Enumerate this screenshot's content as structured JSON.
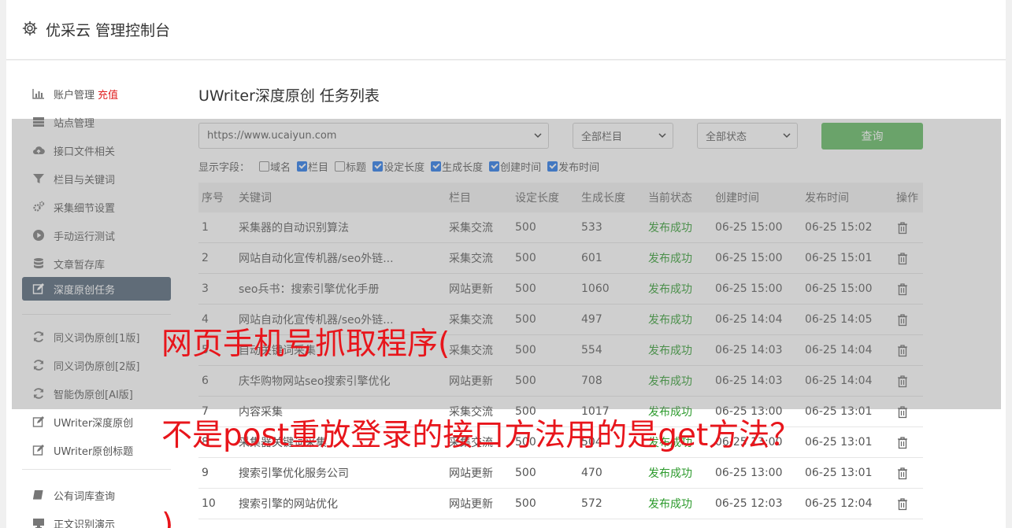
{
  "app": {
    "title": "优采云 管理控制台"
  },
  "sidebar": {
    "items": [
      {
        "label": "账户管理",
        "extra": "充值",
        "icon": "bar-chart-icon"
      },
      {
        "label": "站点管理",
        "icon": "server-icon"
      },
      {
        "label": "接口文件相关",
        "icon": "cloud-upload-icon"
      },
      {
        "label": "栏目与关键词",
        "icon": "filter-icon"
      },
      {
        "label": "采集细节设置",
        "icon": "gears-icon"
      },
      {
        "label": "手动运行测试",
        "icon": "play-circle-icon"
      },
      {
        "label": "文章暂存库",
        "icon": "database-icon"
      },
      {
        "label": "深度原创任务",
        "icon": "edit-icon",
        "active": true
      },
      {
        "label": "同义词伪原创[1版]",
        "icon": "refresh-icon"
      },
      {
        "label": "同义词伪原创[2版]",
        "icon": "refresh-icon"
      },
      {
        "label": "智能伪原创[AI版]",
        "icon": "refresh-icon"
      },
      {
        "label": "UWriter深度原创",
        "icon": "edit-icon"
      },
      {
        "label": "UWriter原创标题",
        "icon": "edit-icon"
      },
      {
        "label": "公有词库查询",
        "icon": "book-icon"
      },
      {
        "label": "正文识别演示",
        "icon": "monitor-icon"
      }
    ]
  },
  "main": {
    "title": "UWriter深度原创 任务列表",
    "filters": {
      "site": "https://www.ucaiyun.com",
      "column": "全部栏目",
      "status": "全部状态",
      "query_label": "查询"
    },
    "fields": {
      "label": "显示字段：",
      "options": [
        {
          "label": "域名",
          "checked": false
        },
        {
          "label": "栏目",
          "checked": true
        },
        {
          "label": "标题",
          "checked": false
        },
        {
          "label": "设定长度",
          "checked": true
        },
        {
          "label": "生成长度",
          "checked": true
        },
        {
          "label": "创建时间",
          "checked": true
        },
        {
          "label": "发布时间",
          "checked": true
        }
      ]
    },
    "table": {
      "headers": [
        "序号",
        "关键词",
        "栏目",
        "设定长度",
        "生成长度",
        "当前状态",
        "创建时间",
        "发布时间",
        "操作"
      ],
      "rows": [
        [
          "1",
          "采集器的自动识别算法",
          "采集交流",
          "500",
          "533",
          "发布成功",
          "06-25 15:00",
          "06-25 15:02"
        ],
        [
          "2",
          "网站自动化宣传机器/seo外链...",
          "采集交流",
          "500",
          "601",
          "发布成功",
          "06-25 15:00",
          "06-25 15:01"
        ],
        [
          "3",
          "seo兵书：搜索引擎优化手册",
          "网站更新",
          "500",
          "1060",
          "发布成功",
          "06-25 15:00",
          "06-25 15:00"
        ],
        [
          "4",
          "网站自动化宣传机器/seo外链...",
          "采集交流",
          "500",
          "497",
          "发布成功",
          "06-25 14:04",
          "06-25 14:05"
        ],
        [
          "5",
          "自动关键词采集",
          "采集交流",
          "500",
          "554",
          "发布成功",
          "06-25 14:03",
          "06-25 14:04"
        ],
        [
          "6",
          "庆华购物网站seo搜索引擎优化",
          "网站更新",
          "500",
          "708",
          "发布成功",
          "06-25 14:03",
          "06-25 14:04"
        ],
        [
          "7",
          "内容采集",
          "采集交流",
          "500",
          "1017",
          "发布成功",
          "06-25 13:00",
          "06-25 13:01"
        ],
        [
          "8",
          "采集器关键词采集",
          "采集交流",
          "500",
          "504",
          "发布成功",
          "06-25 13:00",
          "06-25 13:01"
        ],
        [
          "9",
          "搜索引擎优化服务公司",
          "网站更新",
          "500",
          "470",
          "发布成功",
          "06-25 13:00",
          "06-25 13:01"
        ],
        [
          "10",
          "搜索引擎的网站优化",
          "网站更新",
          "500",
          "572",
          "发布成功",
          "06-25 12:03",
          "06-25 12:04"
        ]
      ]
    }
  },
  "watermark": {
    "line1": "网页手机号抓取程序(",
    "line2": "不是post重放登录的接口方法用的是get方法？",
    "line3": ")"
  },
  "colors": {
    "accent": "#5cb85c",
    "active_nav": "#4d6073",
    "success": "#2c9a2c",
    "watermark": "#e8151b"
  }
}
